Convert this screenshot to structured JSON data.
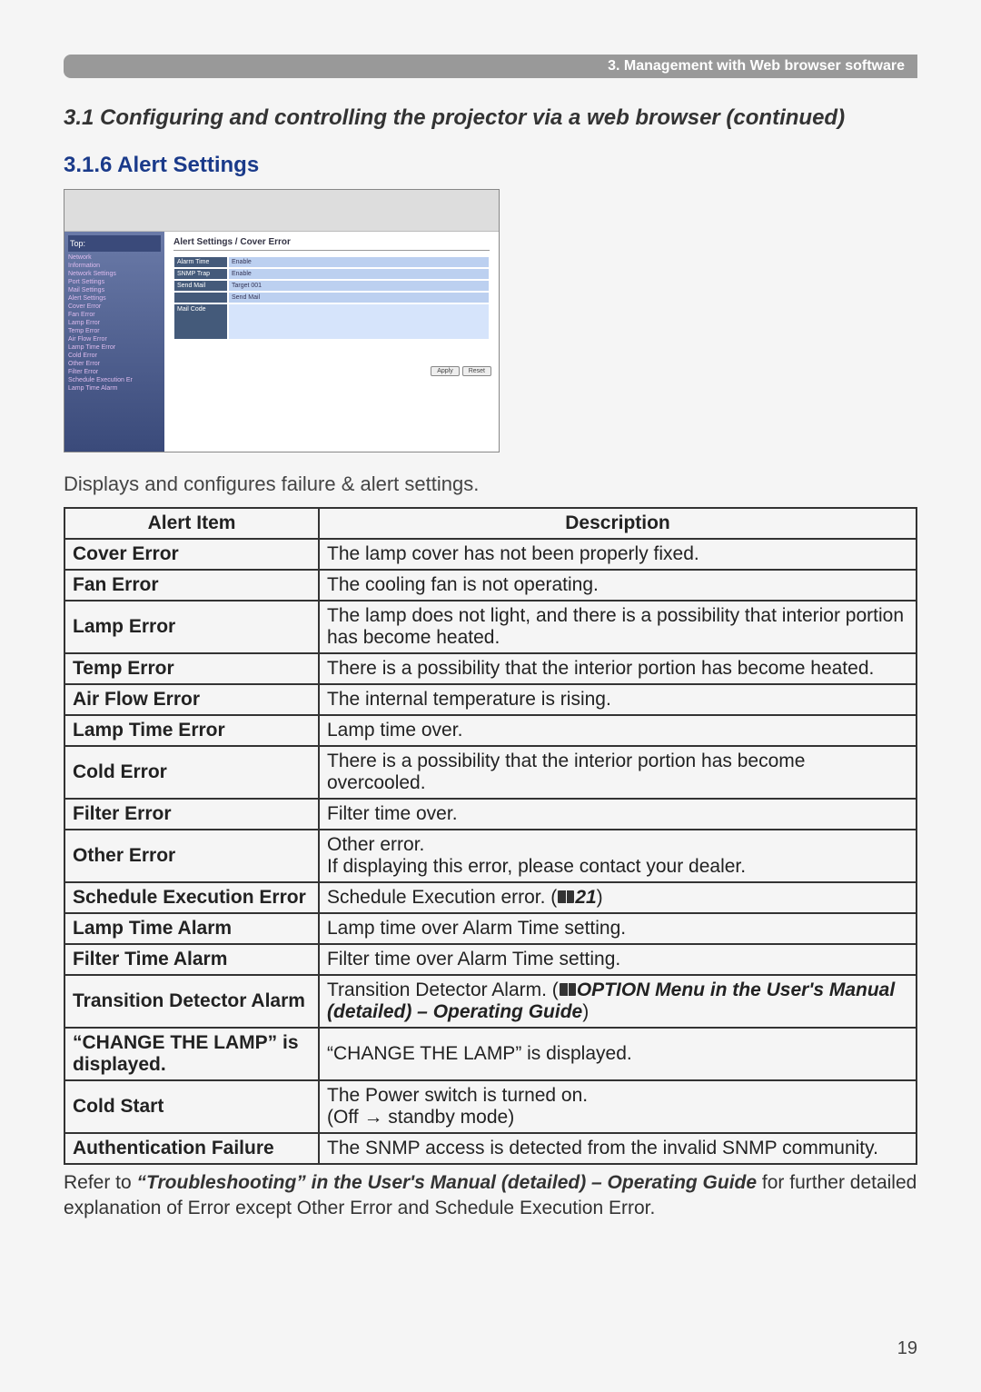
{
  "header_bar": "3. Management with Web browser software",
  "section_title": "3.1 Configuring and controlling the projector via a web browser (continued)",
  "subsection_title": "3.1.6 Alert Settings",
  "screenshot": {
    "panel_title": "Alert Settings / Cover Error",
    "left_head": "Top:",
    "left_items": [
      "Network",
      "Information",
      "Network Settings",
      "Port Settings",
      "Mail Settings",
      "Alert Settings",
      "Cover Error",
      "Fan Error",
      "Lamp Error",
      "Temp Error",
      "Air Flow Error",
      "Lamp Time Error",
      "Cold Error",
      "Other Error",
      "Filter Error",
      "Schedule Execution Er",
      "Lamp Time Alarm"
    ],
    "rows": [
      {
        "a": "Alarm Time",
        "b": "Enable"
      },
      {
        "a": "SNMP Trap",
        "b": "Enable"
      },
      {
        "a": "Send Mail",
        "b": "Target 001"
      },
      {
        "a": "",
        "b": "Send Mail"
      }
    ],
    "bigrow": {
      "a": "Mail Code",
      "b": ""
    },
    "btn_apply": "Apply",
    "btn_reset": "Reset"
  },
  "intro": "Displays and configures failure & alert settings.",
  "table": {
    "h1": "Alert Item",
    "h2": "Description",
    "rows": [
      {
        "item": "Cover Error",
        "desc": "The lamp cover has not been properly fixed."
      },
      {
        "item": "Fan Error",
        "desc": "The cooling fan is not operating."
      },
      {
        "item": "Lamp Error",
        "desc": "The lamp does not light, and there is a possibility that interior portion has become heated."
      },
      {
        "item": "Temp Error",
        "desc": "There is a possibility that the interior portion has become heated."
      },
      {
        "item": "Air Flow Error",
        "desc": "The internal temperature is rising."
      },
      {
        "item": "Lamp Time Error",
        "desc": "Lamp time over."
      },
      {
        "item": "Cold Error",
        "desc": "There is a possibility that the interior portion has become overcooled."
      },
      {
        "item": "Filter Error",
        "desc": "Filter time over."
      },
      {
        "item": "Other Error",
        "desc": "Other error.\nIf displaying this error, please contact your dealer."
      },
      {
        "item": "Schedule Execution Error",
        "desc_pre": "Schedule Execution error. (",
        "ref": "21",
        "desc_post": ")"
      },
      {
        "item": "Lamp Time Alarm",
        "desc": "Lamp time over Alarm Time setting."
      },
      {
        "item": "Filter Time Alarm",
        "desc": "Filter time over Alarm Time setting."
      },
      {
        "item": "Transition Detector Alarm",
        "desc_pre": "Transition Detector Alarm. (",
        "ref_text": "OPTION Menu in the User's Manual (detailed) – Operating Guide",
        "desc_post": ")"
      },
      {
        "item": "“CHANGE THE LAMP” is displayed.",
        "desc": "“CHANGE THE LAMP” is displayed."
      },
      {
        "item": "Cold Start",
        "desc": "The Power switch is turned on.\n(Off → standby mode)"
      },
      {
        "item": "Authentication Failure",
        "desc": "The SNMP access is detected from the invalid SNMP community."
      }
    ]
  },
  "footnote": {
    "pre": "Refer to ",
    "ref": "“Troubleshooting” in the User's Manual (detailed) – Operating Guide",
    "post": " for further detailed explanation of Error except Other Error and Schedule Execution Error."
  },
  "page_number": "19"
}
